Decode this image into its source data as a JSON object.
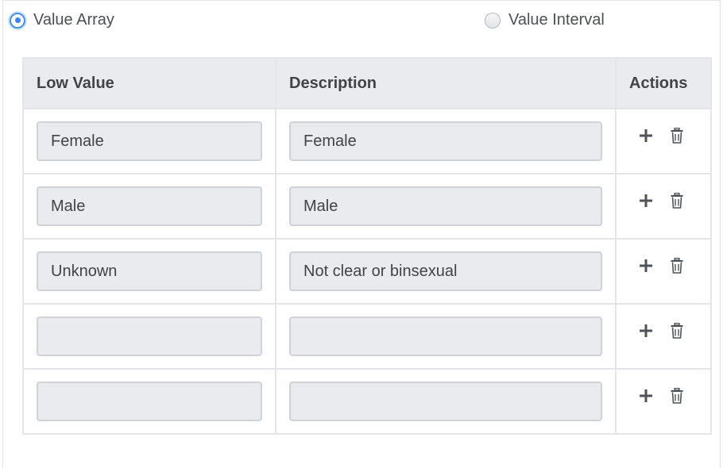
{
  "mode": {
    "options": [
      {
        "label": "Value Array",
        "checked": true
      },
      {
        "label": "Value Interval",
        "checked": false
      }
    ]
  },
  "table": {
    "headers": {
      "low_value": "Low Value",
      "description": "Description",
      "actions": "Actions"
    },
    "rows": [
      {
        "low_value": "Female",
        "description": "Female"
      },
      {
        "low_value": "Male",
        "description": "Male"
      },
      {
        "low_value": "Unknown",
        "description": "Not clear or binsexual"
      },
      {
        "low_value": "",
        "description": ""
      },
      {
        "low_value": "",
        "description": ""
      }
    ]
  },
  "icons": {
    "add": "plus-icon",
    "delete": "trash-icon"
  },
  "colors": {
    "accent": "#4a90e2",
    "header_bg": "#e9ebee",
    "input_bg": "#e9ebee",
    "border": "#e3e5e8"
  }
}
